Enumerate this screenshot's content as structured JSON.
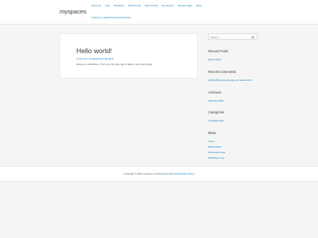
{
  "site": {
    "title": "myspaces",
    "tagline": "Visiting my appointment booking form"
  },
  "nav": {
    "items": [
      "About Us",
      "Cart",
      "Checkout",
      "Client Portal",
      "Client Portal",
      "My account",
      "Sample Page",
      "Shop"
    ]
  },
  "post": {
    "title": "Hello world!",
    "comments_link": "1 Comment",
    "category": "Uncategorized",
    "author": "By admin",
    "meta_sep": "/",
    "excerpt": "Welcome to WordPress. This is your first post. Edit or delete it, then start writing!"
  },
  "sidebar": {
    "search_placeholder": "Search …",
    "recent_posts": {
      "title": "Recent Posts",
      "items": [
        "Hello world!"
      ]
    },
    "recent_comments": {
      "title": "Recent Comments",
      "items": [
        "A WordPress Commenter on Hello world!"
      ]
    },
    "archives": {
      "title": "Archives",
      "items": [
        "February 2021"
      ]
    },
    "categories": {
      "title": "Categories",
      "items": [
        "Uncategorized"
      ]
    },
    "meta": {
      "title": "Meta",
      "items": [
        "Log in",
        "Entries feed",
        "Comments feed",
        "WordPress.org"
      ]
    }
  },
  "footer": {
    "copyright": "Copyright © 2021 myspaces | Powered by",
    "theme_link": "Astra WordPress Theme"
  },
  "colors": {
    "link": "#0274be",
    "text": "#3a3a3a",
    "background": "#f5f5f5"
  }
}
